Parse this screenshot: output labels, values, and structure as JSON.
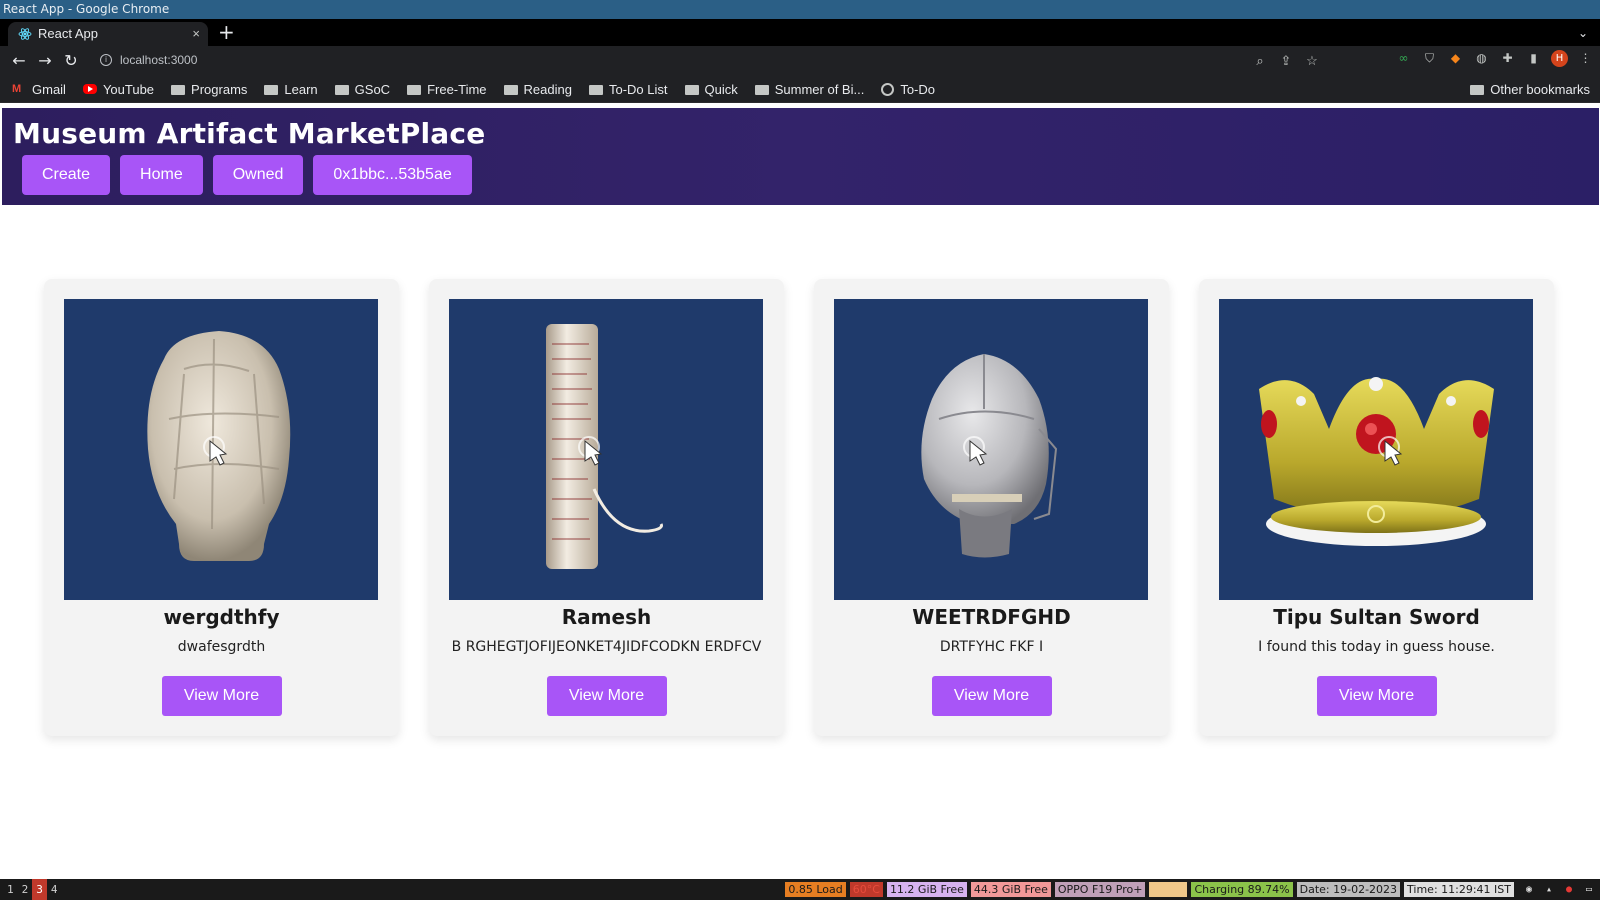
{
  "os": {
    "window_title": "React App - Google Chrome"
  },
  "browser": {
    "tab_title": "React App",
    "tab_close": "×",
    "new_tab": "+",
    "tab_search": "⌄",
    "url": "localhost:3000",
    "bookmarks": [
      {
        "label": "Gmail",
        "icon": "gmail-icon"
      },
      {
        "label": "YouTube",
        "icon": "youtube-icon"
      },
      {
        "label": "Programs",
        "icon": "folder-icon"
      },
      {
        "label": "Learn",
        "icon": "folder-icon"
      },
      {
        "label": "GSoC",
        "icon": "folder-icon"
      },
      {
        "label": "Free-Time",
        "icon": "folder-icon"
      },
      {
        "label": "Reading",
        "icon": "folder-icon"
      },
      {
        "label": "To-Do List",
        "icon": "folder-icon"
      },
      {
        "label": "Quick",
        "icon": "folder-icon"
      },
      {
        "label": "Summer of Bi...",
        "icon": "folder-icon"
      },
      {
        "label": "To-Do",
        "icon": "github-icon"
      }
    ],
    "other_bookmarks": "Other bookmarks",
    "profile_initial": "H"
  },
  "app": {
    "title": "Museum Artifact MarketPlace",
    "nav": {
      "create": "Create",
      "home": "Home",
      "owned": "Owned",
      "account": "0x1bbc...53b5ae"
    },
    "cards": [
      {
        "title": "wergdthfy",
        "description": "dwafesgrdth",
        "button": "View More",
        "artifact": "carved-stone-head"
      },
      {
        "title": "Ramesh",
        "description": "B RGHEGTJOFIJEONKET4JIDFCODKN ERDFCV",
        "button": "View More",
        "artifact": "manuscript-scroll"
      },
      {
        "title": "WEETRDFGHD",
        "description": "DRTFYHC FKF I",
        "button": "View More",
        "artifact": "armor-helmet"
      },
      {
        "title": "Tipu Sultan Sword",
        "description": "I found this today in guess house.",
        "button": "View More",
        "artifact": "golden-crown"
      }
    ],
    "colors": {
      "header_bg": "#2d1e5e",
      "accent": "#a855f7",
      "card_image_bg": "#1f3a6b",
      "card_bg": "#f3f3f3"
    }
  },
  "statusbar": {
    "workspaces": [
      "1",
      "2",
      "3",
      "4"
    ],
    "active_workspace": "3",
    "segments": [
      {
        "text": "0.85 Load",
        "bg": "#e67e22",
        "fg": "#1a1a1a"
      },
      {
        "text": "60°C",
        "bg": "#c0392b",
        "fg": "#e74c3c"
      },
      {
        "text": "11.2 GiB Free",
        "bg": "#d7b3f0",
        "fg": "#1a1a1a"
      },
      {
        "text": "44.3 GiB Free",
        "bg": "#f19999",
        "fg": "#1a1a1a"
      },
      {
        "text": "OPPO F19 Pro+",
        "bg": "#c0a0b8",
        "fg": "#1a1a1a"
      },
      {
        "text": "",
        "bg": "#f0c88a",
        "fg": "#1a1a1a"
      },
      {
        "text": "Charging 89.74%",
        "bg": "#8bc34a",
        "fg": "#1a1a1a"
      },
      {
        "text": "Date: 19-02-2023",
        "bg": "#bdbdbd",
        "fg": "#1a1a1a"
      },
      {
        "text": "Time: 11:29:41 IST",
        "bg": "#e0e0e0",
        "fg": "#1a1a1a"
      }
    ]
  }
}
